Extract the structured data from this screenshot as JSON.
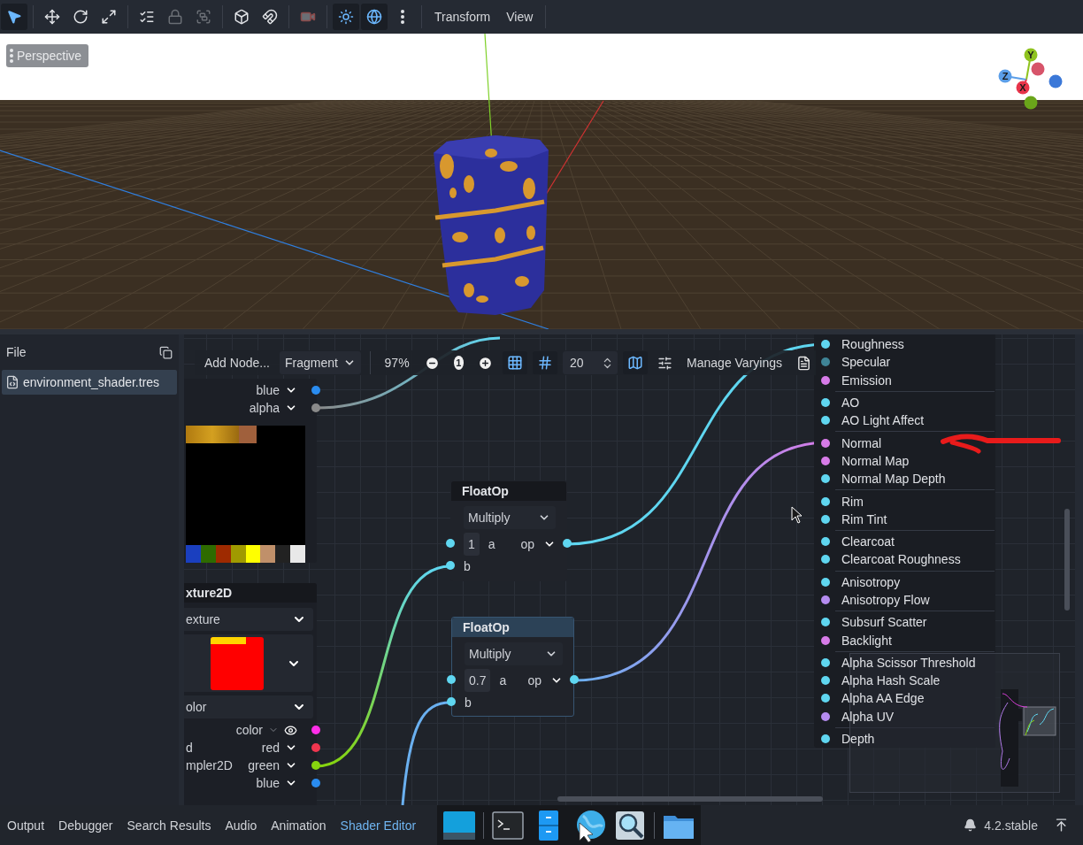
{
  "toolbar": {
    "tool_groups": [
      {
        "tools": [
          {
            "kind": "select",
            "selected": true,
            "disabled": false
          }
        ]
      },
      {
        "tools": [
          {
            "kind": "move",
            "selected": false,
            "disabled": false
          },
          {
            "kind": "rotate",
            "selected": false,
            "disabled": false
          },
          {
            "kind": "scale",
            "selected": false,
            "disabled": false
          }
        ]
      },
      {
        "tools": [
          {
            "kind": "list_select",
            "selected": false,
            "disabled": false
          },
          {
            "kind": "lock",
            "selected": false,
            "disabled": true
          },
          {
            "kind": "group",
            "selected": false,
            "disabled": true
          }
        ]
      },
      {
        "tools": [
          {
            "kind": "snap_object",
            "selected": false,
            "disabled": false
          },
          {
            "kind": "magnet",
            "selected": false,
            "disabled": false
          }
        ]
      },
      {
        "tools": [
          {
            "kind": "camera",
            "selected": false,
            "disabled": true
          }
        ]
      },
      {
        "tools": [
          {
            "kind": "sun",
            "selected": true,
            "disabled": false
          },
          {
            "kind": "environment",
            "selected": true,
            "disabled": false
          },
          {
            "kind": "more",
            "selected": false,
            "disabled": false
          }
        ]
      }
    ],
    "menus": [
      "Transform",
      "View"
    ]
  },
  "viewport": {
    "view_menu": "Perspective",
    "gizmo": [
      {
        "label": "Y",
        "color": "#8fc31f"
      },
      {
        "label": "Z",
        "color": "#5b9ee8"
      },
      {
        "label": "X",
        "color": "#e8344a"
      }
    ]
  },
  "file_panel": {
    "menu": "File",
    "files": [
      {
        "name": "environment_shader.tres",
        "selected": true
      }
    ]
  },
  "graph": {
    "toolbar": {
      "add_node": "Add Node...",
      "mode": "Fragment",
      "zoom": "97%",
      "zoom_reset": "1",
      "snap_distance": "20",
      "manage_varyings": "Manage Varyings",
      "toggles": [
        {
          "kind": "grid",
          "selected": true
        },
        {
          "kind": "snap",
          "selected": true
        },
        {
          "kind": "minimap",
          "selected": true
        }
      ]
    },
    "top_texture_node": {
      "ports": [
        {
          "output": "blue",
          "color": "#2a8cf0"
        },
        {
          "output": "alpha",
          "color": "#8a8a8a"
        }
      ]
    },
    "texture_node": {
      "title": "xture2D",
      "source": "exture",
      "texture_type": "olor",
      "ports": [
        {
          "kind": "color",
          "output": "color",
          "color": "#ff2ee8"
        },
        {
          "kind": "scalar",
          "input": "d",
          "output": "red",
          "color": "#f0364f"
        },
        {
          "kind": "scalar",
          "input": "mpler2D",
          "output": "green",
          "color": "#86d40f"
        },
        {
          "kind": "scalar",
          "output": "blue",
          "color": "#2a8cf0"
        }
      ]
    },
    "float_ops": [
      {
        "title": "FloatOp",
        "operator": "Multiply",
        "a_value": "1",
        "a_label": "a",
        "b_label": "b",
        "output": "op",
        "selected": false
      },
      {
        "title": "FloatOp",
        "operator": "Multiply",
        "a_value": "0.7",
        "a_label": "a",
        "b_label": "b",
        "output": "op",
        "selected": true
      }
    ],
    "output_node": {
      "groups": [
        {
          "ports": [
            {
              "label": "Roughness",
              "color": "#5fd6f0"
            },
            {
              "label": "Specular",
              "color": "#3f8496"
            },
            {
              "label": "Emission",
              "color": "#d77be8"
            }
          ]
        },
        {
          "ports": [
            {
              "label": "AO",
              "color": "#5fd6f0"
            },
            {
              "label": "AO Light Affect",
              "color": "#5fd6f0"
            }
          ]
        },
        {
          "ports": [
            {
              "label": "Normal",
              "color": "#d77be8"
            },
            {
              "label": "Normal Map",
              "color": "#d77be8"
            },
            {
              "label": "Normal Map Depth",
              "color": "#5fd6f0"
            }
          ]
        },
        {
          "ports": [
            {
              "label": "Rim",
              "color": "#5fd6f0"
            },
            {
              "label": "Rim Tint",
              "color": "#5fd6f0"
            }
          ]
        },
        {
          "ports": [
            {
              "label": "Clearcoat",
              "color": "#5fd6f0"
            },
            {
              "label": "Clearcoat Roughness",
              "color": "#5fd6f0"
            }
          ]
        },
        {
          "ports": [
            {
              "label": "Anisotropy",
              "color": "#5fd6f0"
            },
            {
              "label": "Anisotropy Flow",
              "color": "#b58cf0"
            }
          ]
        },
        {
          "ports": [
            {
              "label": "Subsurf Scatter",
              "color": "#5fd6f0"
            },
            {
              "label": "Backlight",
              "color": "#d77be8"
            }
          ]
        },
        {
          "ports": [
            {
              "label": "Alpha Scissor Threshold",
              "color": "#5fd6f0"
            },
            {
              "label": "Alpha Hash Scale",
              "color": "#5fd6f0"
            },
            {
              "label": "Alpha AA Edge",
              "color": "#5fd6f0"
            },
            {
              "label": "Alpha UV",
              "color": "#b58cf0"
            }
          ]
        },
        {
          "ports": [
            {
              "label": "Depth",
              "color": "#5fd6f0"
            }
          ]
        }
      ]
    }
  },
  "bottom_bar": {
    "tabs": [
      {
        "label": "Output",
        "selected": false
      },
      {
        "label": "Debugger",
        "selected": false
      },
      {
        "label": "Search Results",
        "selected": false
      },
      {
        "label": "Audio",
        "selected": false
      },
      {
        "label": "Animation",
        "selected": false
      },
      {
        "label": "Shader Editor",
        "selected": true
      }
    ],
    "dock": [
      {
        "kind": "window"
      },
      {
        "kind": "terminal"
      },
      {
        "kind": "files"
      },
      {
        "kind": "browser"
      },
      {
        "kind": "search"
      },
      {
        "kind": "folder"
      }
    ],
    "version": "4.2.stable"
  }
}
